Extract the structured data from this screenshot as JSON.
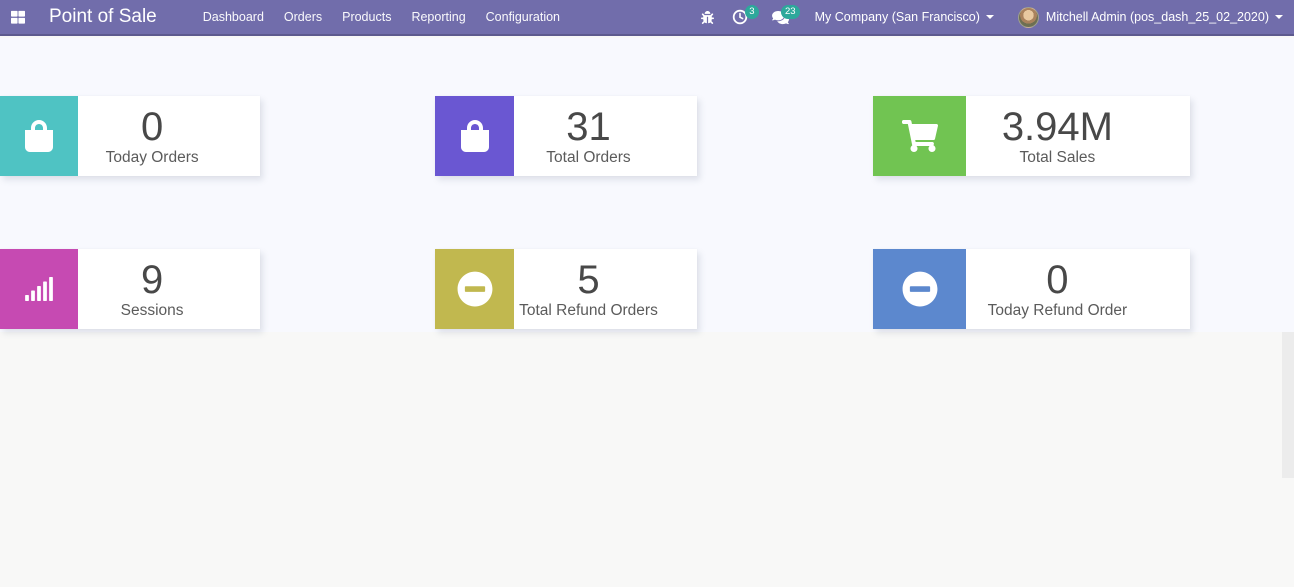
{
  "navbar": {
    "brand": "Point of Sale",
    "menu_items": [
      "Dashboard",
      "Orders",
      "Products",
      "Reporting",
      "Configuration"
    ],
    "activity_badge": "3",
    "message_badge": "23",
    "company": "My Company (San Francisco)",
    "user": "Mitchell Admin (pos_dash_25_02_2020)"
  },
  "colors": {
    "navbar_bg": "#716dab",
    "navbar_border": "#5d5a8e",
    "badge_bg": "#2da89b",
    "page_bg_top": "#f8f9fe",
    "page_bg_bottom": "#f8f8f7"
  },
  "cards": [
    {
      "id": "today-orders",
      "value": "0",
      "label": "Today Orders",
      "color": "#4fc3c3",
      "icon": "shopping-bag-icon"
    },
    {
      "id": "total-orders",
      "value": "31",
      "label": "Total Orders",
      "color": "#6a57d2",
      "icon": "shopping-bag-icon"
    },
    {
      "id": "total-sales",
      "value": "3.94M",
      "label": "Total Sales",
      "color": "#71c452",
      "icon": "shopping-cart-icon"
    },
    {
      "id": "sessions",
      "value": "9",
      "label": "Sessions",
      "color": "#c64ab2",
      "icon": "signal-bars-icon"
    },
    {
      "id": "total-refund-orders",
      "value": "5",
      "label": "Total Refund Orders",
      "color": "#c1b84f",
      "icon": "minus-circle-icon"
    },
    {
      "id": "today-refund-order",
      "value": "0",
      "label": "Today Refund Order",
      "color": "#5c88ce",
      "icon": "minus-circle-icon"
    }
  ]
}
